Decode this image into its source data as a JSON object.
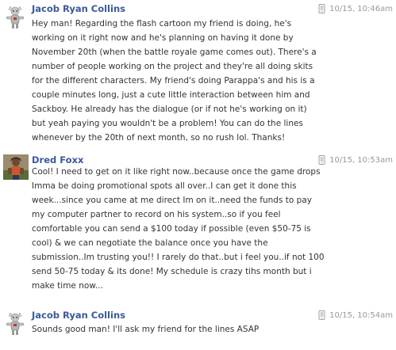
{
  "messages": [
    {
      "sender": "Jacob Ryan Collins",
      "avatar": "jacob-avatar",
      "timestamp": "10/15, 10:46am",
      "via_icon": "mobile-phone-icon",
      "lines": [
        "Hey man! Regarding the flash cartoon my friend is doing, he's",
        "working on it right now and he's planning on having it done by",
        "November 20th (when the battle royale game comes out). There's a",
        "number of people working on the project and they're all doing skits",
        "for the different characters. My friend's doing Parappa's and his is a",
        "couple minutes long, just a cute little interaction between him and",
        "Sackboy. He already has the dialogue (or if not he's working on it)",
        "but yeah paying you wouldn't be a problem! You can do the lines",
        "whenever by the 20th of next month, so no rush lol. Thanks!"
      ]
    },
    {
      "sender": "Dred Foxx",
      "avatar": "dred-avatar",
      "timestamp": "10/15, 10:53am",
      "via_icon": "mobile-phone-icon",
      "lines": [
        "Cool! I need to get on it like right now..because once the game drops",
        "Imma be doing promotional spots all over..I can get it done this",
        "week...since you came at me direct Im on it..need the funds to pay",
        "my computer partner to record on his system..so if you feel",
        "comfortable you can send a $100 today if possible (even $50-75 is",
        "cool) & we can negotiate the balance once you have the",
        "submission..Im trusting you!! I rarely do that..but i feel you..if not 100",
        "send 50-75 today & its done! My schedule is crazy tihs month but i",
        "make time now..."
      ]
    },
    {
      "sender": "Jacob Ryan Collins",
      "avatar": "jacob-avatar",
      "timestamp": "10/15, 10:54am",
      "via_icon": "mobile-phone-icon",
      "lines": [
        "Sounds good man! I'll ask my friend for the lines ASAP"
      ]
    }
  ],
  "colors": {
    "sender_link": "#3b5998",
    "body_text": "#333333",
    "timestamp": "#999999",
    "background": "#ffffff"
  }
}
